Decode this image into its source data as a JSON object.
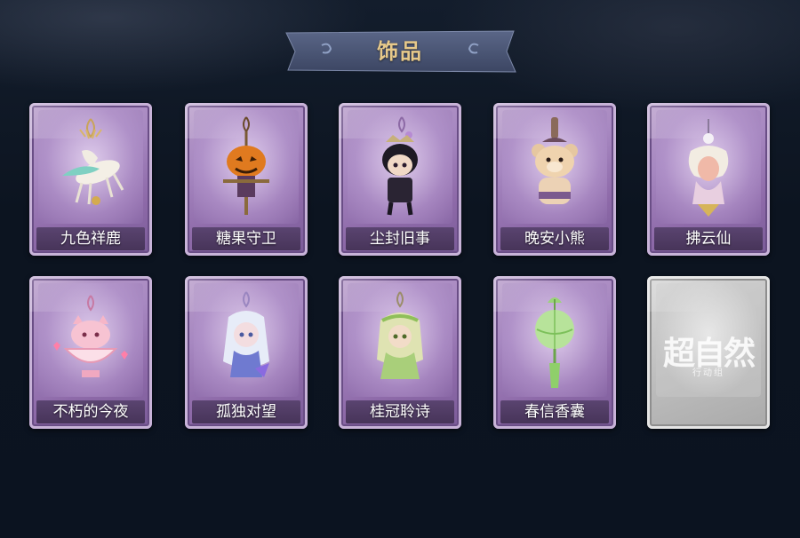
{
  "header": {
    "title": "饰品"
  },
  "accessories": [
    {
      "name": "九色祥鹿",
      "icon": "deer-charm-icon"
    },
    {
      "name": "糖果守卫",
      "icon": "pumpkin-scarecrow-charm-icon"
    },
    {
      "name": "尘封旧事",
      "icon": "chibi-gentleman-charm-icon"
    },
    {
      "name": "晚安小熊",
      "icon": "teddy-bear-charm-icon"
    },
    {
      "name": "拂云仙",
      "icon": "cloud-fairy-charm-icon"
    },
    {
      "name": "不朽的今夜",
      "icon": "pink-fox-teacup-charm-icon"
    },
    {
      "name": "孤独对望",
      "icon": "blue-girl-charm-icon"
    },
    {
      "name": "桂冠聆诗",
      "icon": "laurel-girl-charm-icon"
    },
    {
      "name": "春信香囊",
      "icon": "green-sachet-charm-icon"
    }
  ],
  "locked_card": {
    "watermark_title": "超自然",
    "watermark_subtitle": "行动组",
    "icon": "watermark-logo-icon"
  },
  "colors": {
    "background": "#0d1624",
    "card_purple": "#a788c1",
    "label_bar": "#4e3a62",
    "title_gold": "#e7c98a"
  }
}
